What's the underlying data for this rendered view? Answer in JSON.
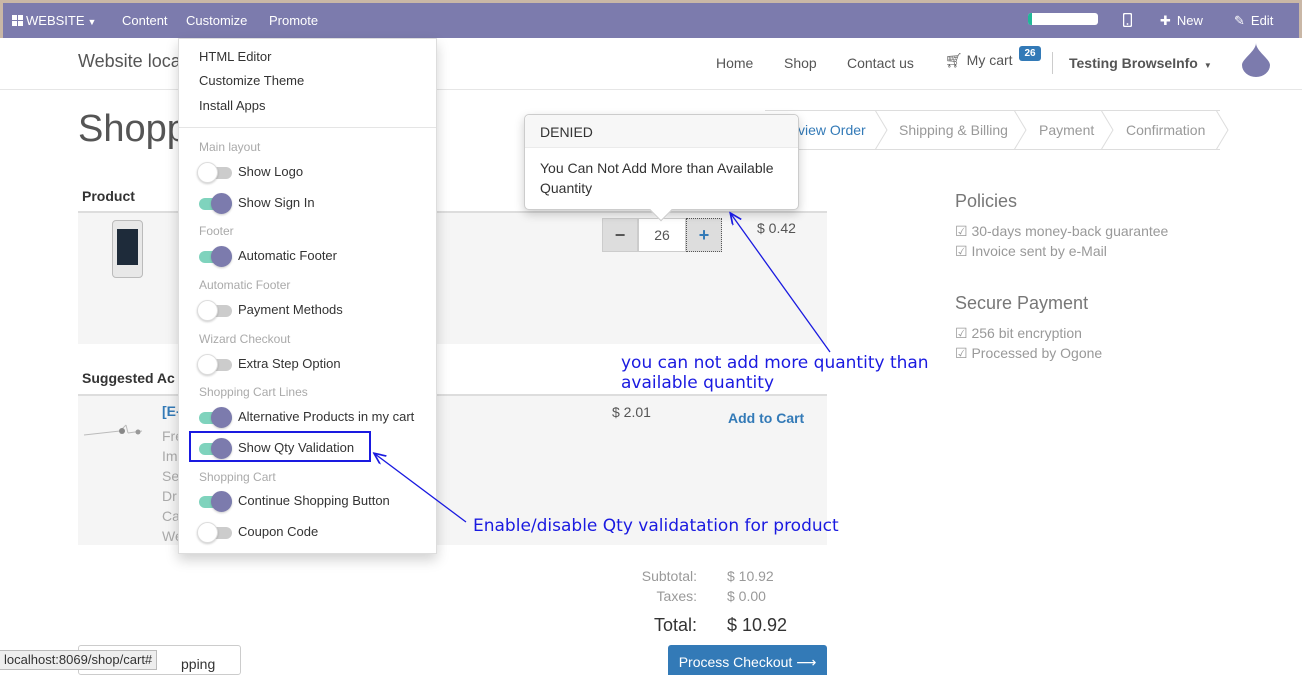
{
  "admin": {
    "website_label": "WEBSITE",
    "menu": [
      "Content",
      "Customize",
      "Promote"
    ],
    "progress": 0.05,
    "new_label": "New",
    "edit_label": "Edit"
  },
  "site": {
    "title": "Website loca",
    "nav": [
      "Home",
      "Shop",
      "Contact us"
    ],
    "cart_label": "My cart",
    "cart_count": "26",
    "user": "Testing BrowseInfo"
  },
  "page": {
    "title": "Shopp",
    "wizard": [
      "view Order",
      "Shipping & Billing",
      "Payment",
      "Confirmation"
    ]
  },
  "cart": {
    "product_header": "Product",
    "quantity": "26",
    "price": "$ 0.42",
    "suggested_header": "Suggested Ac",
    "suggested_name": "[E-",
    "suggested_lines": [
      "Fre",
      "Im",
      "Se",
      "Dr",
      "Ca",
      "We"
    ],
    "suggested_price": "$ 2.01",
    "add_to_cart": "Add to Cart"
  },
  "popover": {
    "title": "DENIED",
    "body": "You Can Not Add More than Available Quantity"
  },
  "sidebar": {
    "policies_title": "Policies",
    "policies": [
      "☑ 30-days money-back guarantee",
      "☑ Invoice sent by e-Mail"
    ],
    "secure_title": "Secure Payment",
    "secure": [
      "☑ 256 bit encryption",
      "☑ Processed by Ogone"
    ]
  },
  "customize_menu": {
    "items": [
      "HTML Editor",
      "Customize Theme",
      "Install Apps"
    ],
    "sections": {
      "main_layout": "Main layout",
      "footer": "Footer",
      "automatic_footer": "Automatic Footer",
      "wizard_checkout": "Wizard Checkout",
      "cart_lines": "Shopping Cart Lines",
      "shopping_cart": "Shopping Cart"
    },
    "toggles": [
      {
        "label": "Show Logo",
        "on": false
      },
      {
        "label": "Show Sign In",
        "on": true
      },
      {
        "label": "Automatic Footer",
        "on": true
      },
      {
        "label": "Payment Methods",
        "on": false
      },
      {
        "label": "Extra Step Option",
        "on": false
      },
      {
        "label": "Alternative Products in my cart",
        "on": true
      },
      {
        "label": "Show Qty Validation",
        "on": true
      },
      {
        "label": "Continue Shopping Button",
        "on": true
      },
      {
        "label": "Coupon Code",
        "on": false
      }
    ]
  },
  "annotations": {
    "qty_note_1": "you can not add more quantity than",
    "qty_note_2": "available quantity",
    "toggle_note": "Enable/disable Qty validatation for product"
  },
  "totals": {
    "subtotal_label": "Subtotal:",
    "subtotal": "$ 10.92",
    "taxes_label": "Taxes:",
    "taxes": "$ 0.00",
    "total_label": "Total:",
    "total": "$ 10.92"
  },
  "footer": {
    "status_url": "localhost:8069/shop/cart#",
    "continue_label": "pping",
    "checkout_label": "Process Checkout ⟶"
  }
}
